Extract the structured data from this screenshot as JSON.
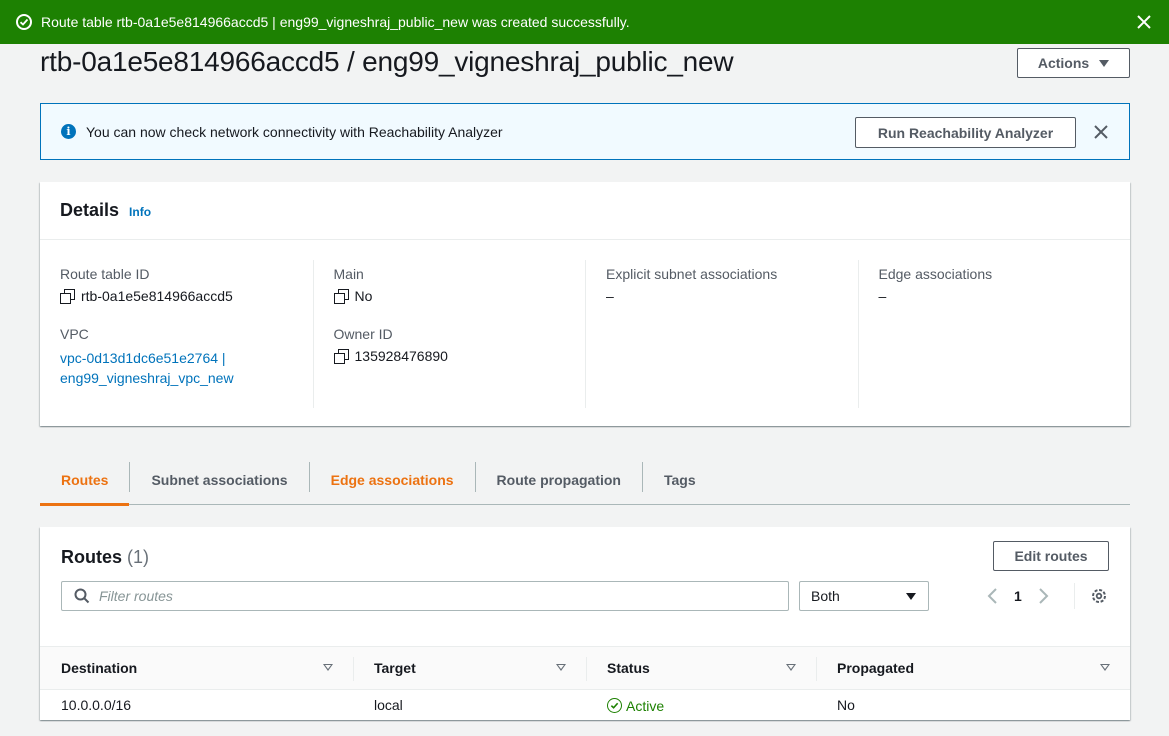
{
  "flash": {
    "message": "Route table rtb-0a1e5e814966accd5 | eng99_vigneshraj_public_new was created successfully.",
    "color": "#1d8102"
  },
  "page": {
    "title": "rtb-0a1e5e814966accd5 / eng99_vigneshraj_public_new",
    "actions_label": "Actions"
  },
  "info_alert": {
    "message": "You can now check network connectivity with Reachability Analyzer",
    "button_label": "Run Reachability Analyzer"
  },
  "details": {
    "title": "Details",
    "info_label": "Info",
    "route_table_id_label": "Route table ID",
    "route_table_id": "rtb-0a1e5e814966accd5",
    "vpc_label": "VPC",
    "vpc_line1": "vpc-0d13d1dc6e51e2764 |",
    "vpc_line2": "eng99_vigneshraj_vpc_new",
    "main_label": "Main",
    "main_value": "No",
    "owner_id_label": "Owner ID",
    "owner_id": "135928476890",
    "explicit_subnet_label": "Explicit subnet associations",
    "explicit_subnet_value": "–",
    "edge_assoc_label": "Edge associations",
    "edge_assoc_value": "–"
  },
  "tabs": [
    {
      "label": "Routes",
      "active": true
    },
    {
      "label": "Subnet associations"
    },
    {
      "label": "Edge associations"
    },
    {
      "label": "Route propagation"
    },
    {
      "label": "Tags"
    }
  ],
  "routes": {
    "title": "Routes",
    "count": "(1)",
    "edit_label": "Edit routes",
    "filter_placeholder": "Filter routes",
    "select_value": "Both",
    "page_number": "1",
    "columns": [
      "Destination",
      "Target",
      "Status",
      "Propagated"
    ],
    "rows": [
      {
        "destination": "10.0.0.0/16",
        "target": "local",
        "status": "Active",
        "propagated": "No"
      }
    ]
  },
  "colors": {
    "accent_orange": "#ec7211",
    "link_blue": "#0073bb",
    "success_green": "#1d8102"
  }
}
